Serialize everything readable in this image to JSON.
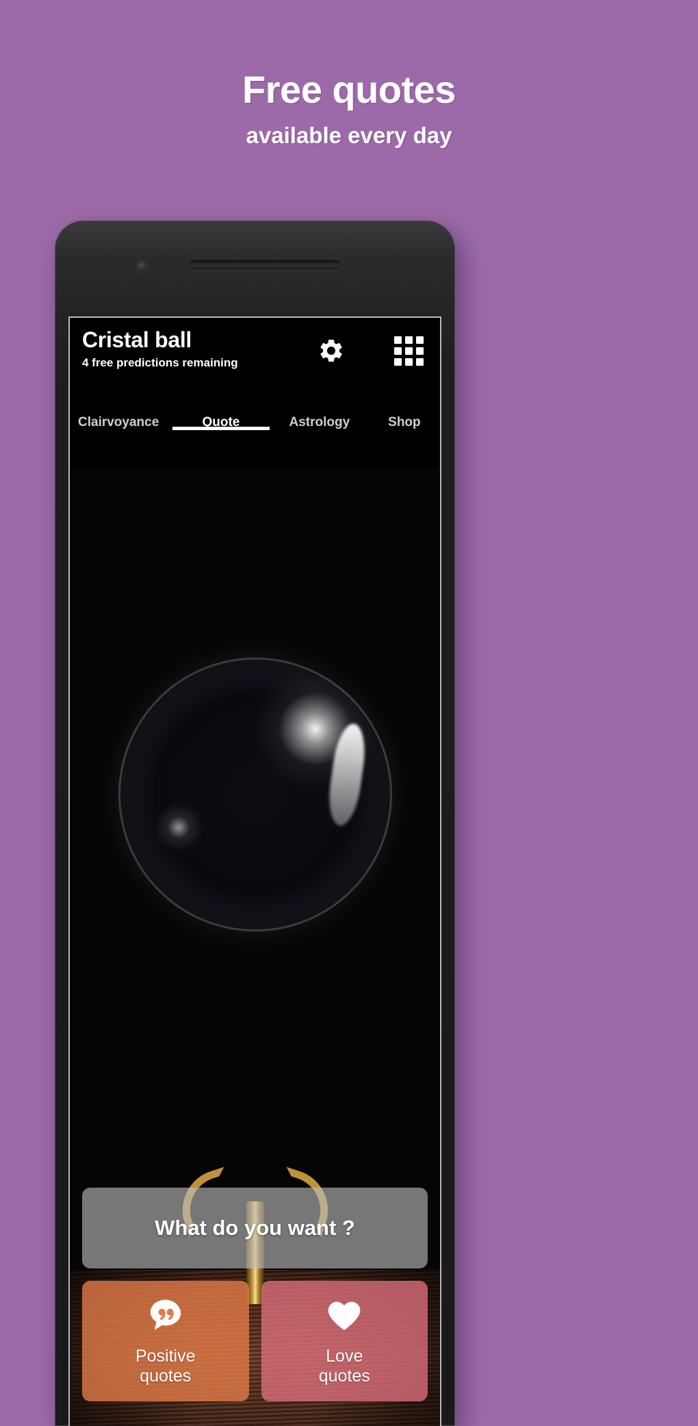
{
  "promo": {
    "title": "Free quotes",
    "subtitle": "available every day",
    "background_color": "#9c6aa8"
  },
  "app": {
    "title": "Cristal ball",
    "subtitle": "4 free predictions remaining",
    "actions": [
      {
        "name": "settings",
        "icon": "gear-icon"
      },
      {
        "name": "apps",
        "icon": "grid-icon"
      }
    ],
    "tabs": [
      {
        "label": "Clairvoyance",
        "active": false
      },
      {
        "label": "Quote",
        "active": true
      },
      {
        "label": "Astrology",
        "active": false
      },
      {
        "label": "Shop",
        "active": false
      }
    ],
    "prompt": "What do you want ?",
    "cards": [
      {
        "label_line1": "Positive",
        "label_line2": "quotes",
        "icon": "quote-bubble-icon",
        "color": "#e27a49"
      },
      {
        "label_line1": "Love",
        "label_line2": "quotes",
        "icon": "heart-icon",
        "color": "#de707c"
      }
    ]
  }
}
